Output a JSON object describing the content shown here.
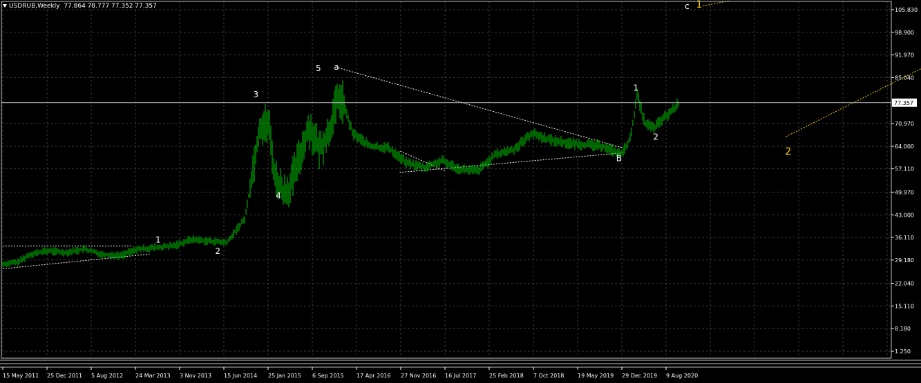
{
  "header": {
    "symbol": "USDRUB,Weekly",
    "ohlc": "77.864 78.777 77.352 77.357"
  },
  "colors": {
    "background": "#000000",
    "grid": "#3a3a3a",
    "candles": "#00c800",
    "wave_white": "#ffffff",
    "wave_yellow": "#ffd700",
    "price_line": "#c0c0c0"
  },
  "chart_data": {
    "type": "line",
    "symbol": "USDRUB",
    "timeframe": "Weekly",
    "last_price": "77.357",
    "y_ticks": [
      "105.830",
      "98.900",
      "91.970",
      "85.040",
      "77.357",
      "70.970",
      "64.000",
      "57.110",
      "49.970",
      "43.000",
      "36.110",
      "29.180",
      "22.040",
      "15.110",
      "8.180",
      "1.250"
    ],
    "x_ticks": [
      "15 May 2011",
      "25 Dec 2011",
      "5 Aug 2012",
      "24 Mar 2013",
      "3 Nov 2013",
      "15 Jun 2014",
      "25 Jan 2015",
      "6 Sep 2015",
      "17 Apr 2016",
      "27 Nov 2016",
      "16 Jul 2017",
      "25 Feb 2018",
      "7 Oct 2018",
      "19 May 2019",
      "29 Dec 2019",
      "9 Aug 2020"
    ],
    "ylim": [
      1.25,
      107.5
    ],
    "grid": true,
    "series": [
      {
        "x": [
          "2011-05-15",
          "2011-08-01",
          "2011-10-01",
          "2012-01-01",
          "2012-04-01",
          "2012-07-01",
          "2012-10-01",
          "2013-01-01",
          "2013-04-01",
          "2013-07-01",
          "2013-10-01",
          "2014-01-01",
          "2014-04-01",
          "2014-07-01",
          "2014-10-01",
          "2014-12-15",
          "2015-01-30",
          "2015-03-01",
          "2015-04-15",
          "2015-05-15",
          "2015-07-01",
          "2015-08-24",
          "2015-10-15",
          "2015-12-01",
          "2016-01-20",
          "2016-02-15",
          "2016-04-01",
          "2016-07-01",
          "2016-10-01",
          "2017-01-01",
          "2017-04-01",
          "2017-07-01",
          "2017-10-01",
          "2018-01-01",
          "2018-04-01",
          "2018-07-01",
          "2018-10-01",
          "2019-01-01",
          "2019-04-01",
          "2019-07-01",
          "2019-10-01",
          "2020-01-01",
          "2020-02-20",
          "2020-03-20",
          "2020-05-01",
          "2020-06-15",
          "2020-08-01",
          "2020-09-01",
          "2020-10-25"
        ],
        "y": [
          28.0,
          28.5,
          31.0,
          32.0,
          31.5,
          32.5,
          31.0,
          30.5,
          32.5,
          33.0,
          33.5,
          35.5,
          35.0,
          34.5,
          42.0,
          70.0,
          71.0,
          55.0,
          50.0,
          51.0,
          60.0,
          70.0,
          63.0,
          68.0,
          79.0,
          77.0,
          68.0,
          64.0,
          63.5,
          59.0,
          57.5,
          59.5,
          57.0,
          56.5,
          61.5,
          63.0,
          68.0,
          66.0,
          65.0,
          64.5,
          64.0,
          61.5,
          67.0,
          80.0,
          71.0,
          69.5,
          72.5,
          74.0,
          77.357
        ]
      }
    ],
    "wave_labels_white": [
      {
        "text": "1",
        "x": "2013-07-15",
        "y": 34.5
      },
      {
        "text": "2",
        "x": "2014-05-15",
        "y": 31.0
      },
      {
        "text": "3",
        "x": "2014-11-25",
        "y": 79.0
      },
      {
        "text": "4",
        "x": "2015-03-20",
        "y": 48.0
      },
      {
        "text": "5",
        "x": "2015-10-10",
        "y": 87.0
      },
      {
        "text": "a",
        "x": "2016-01-10",
        "y": 87.5
      },
      {
        "text": "B",
        "x": "2019-12-20",
        "y": 59.5
      },
      {
        "text": "1",
        "x": "2020-03-15",
        "y": 81.0
      },
      {
        "text": "2",
        "x": "2020-06-25",
        "y": 66.0
      },
      {
        "text": "c",
        "x": "2020-12-01",
        "y": 106.0
      }
    ],
    "wave_labels_yellow": [
      {
        "text": "1",
        "x": "2021-02-01",
        "y": 106.5
      },
      {
        "text": "2",
        "x": "2022-05-01",
        "y": 61.5
      }
    ]
  }
}
